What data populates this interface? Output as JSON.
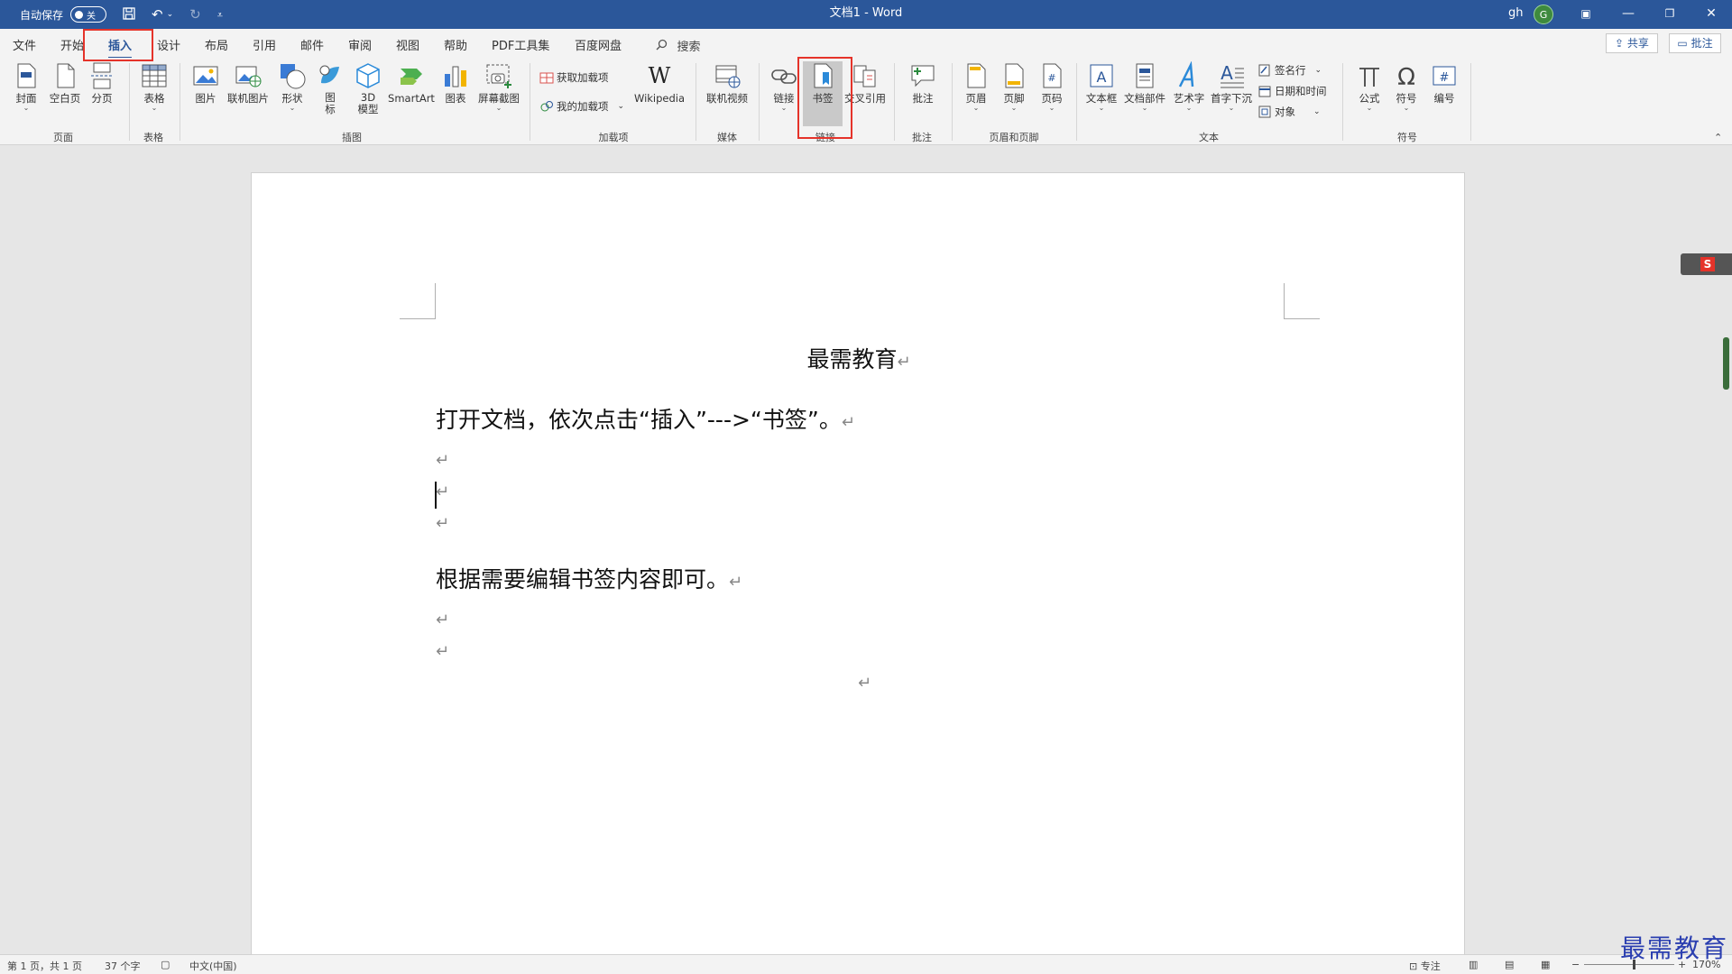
{
  "titlebar": {
    "autosave_label": "自动保存",
    "autosave_state": "关",
    "doc_title": "文档1  -  Word",
    "user": "gh",
    "avatar_initial": "G"
  },
  "tabs": [
    {
      "label": "文件"
    },
    {
      "label": "开始"
    },
    {
      "label": "插入",
      "active": true
    },
    {
      "label": "设计"
    },
    {
      "label": "布局"
    },
    {
      "label": "引用"
    },
    {
      "label": "邮件"
    },
    {
      "label": "审阅"
    },
    {
      "label": "视图"
    },
    {
      "label": "帮助"
    },
    {
      "label": "PDF工具集"
    },
    {
      "label": "百度网盘"
    }
  ],
  "search_label": "搜索",
  "share_label": "共享",
  "comments_label": "批注",
  "ribbon": {
    "pages": {
      "cover": "封面",
      "blank": "空白页",
      "break": "分页",
      "group": "页面"
    },
    "tables": {
      "table": "表格",
      "group": "表格"
    },
    "illustrations": {
      "picture": "图片",
      "online_picture": "联机图片",
      "shapes": "形状",
      "icons": "图\n标",
      "model3d": "3D\n模型",
      "smartart": "SmartArt",
      "chart": "图表",
      "screenshot": "屏幕截图",
      "group": "插图"
    },
    "addins": {
      "get": "获取加载项",
      "my": "我的加载项",
      "wikipedia": "Wikipedia",
      "group": "加载项"
    },
    "media": {
      "online_video": "联机视频",
      "group": "媒体"
    },
    "links": {
      "link": "链接",
      "bookmark": "书签",
      "crossref": "交叉引用",
      "group": "链接"
    },
    "comments": {
      "comment": "批注",
      "group": "批注"
    },
    "header_footer": {
      "header": "页眉",
      "footer": "页脚",
      "page_number": "页码",
      "group": "页眉和页脚"
    },
    "text": {
      "textbox": "文本框",
      "quick_parts": "文档部件",
      "wordart": "艺术字",
      "dropcap": "首字下沉",
      "signature": "签名行",
      "datetime": "日期和时间",
      "object": "对象",
      "group": "文本"
    },
    "symbols": {
      "equation": "公式",
      "symbol": "符号",
      "number": "编号",
      "group": "符号"
    }
  },
  "document": {
    "title": "最需教育",
    "para1": "打开文档，依次点击“插入”--->“书签”。",
    "para2": "根据需要编辑书签内容即可。",
    "para_mark": "↵"
  },
  "ime_label": "S",
  "status": {
    "page": "第 1 页，共 1 页",
    "words": "37 个字",
    "language": "中文(中国)",
    "focus": "专注",
    "zoom": "170%"
  },
  "watermark": "最需教育",
  "colors": {
    "accent": "#2b579a",
    "annotation": "#e5332a"
  }
}
